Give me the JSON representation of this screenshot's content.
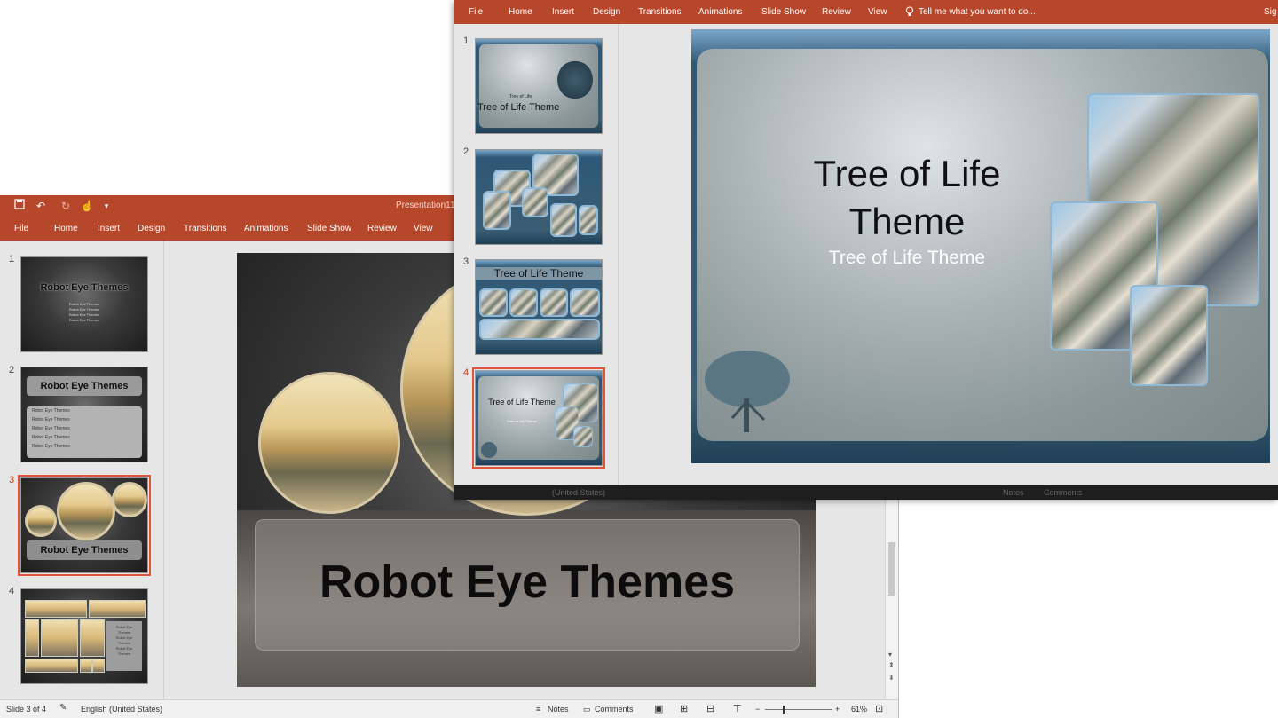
{
  "win1": {
    "doc_title": "Presentation11 -",
    "tabs": [
      "File",
      "Home",
      "Insert",
      "Design",
      "Transitions",
      "Animations",
      "Slide Show",
      "Review",
      "View"
    ],
    "thumbs": [
      {
        "num": "1",
        "title": "Robot Eye Themes",
        "lines": [
          "Robot Eye Themes",
          "Robot Eye Themes",
          "Robot Eye Themes",
          "Robot Eye Themes"
        ]
      },
      {
        "num": "2",
        "title": "Robot Eye Themes",
        "bullets": [
          "Robot Eye Themes",
          "Robot Eye Themes",
          "Robot Eye Themes",
          "Robot Eye Themes",
          "Robot Eye Themes"
        ]
      },
      {
        "num": "3",
        "title": "Robot Eye Themes"
      },
      {
        "num": "4",
        "lines": [
          "Robot Eye",
          "Themes",
          "Robot Eye",
          "Themes",
          "Robot Eye",
          "Themes"
        ]
      }
    ],
    "slide_title": "Robot Eye Themes",
    "status": {
      "slide": "Slide 3 of 4",
      "language": "English (United States)",
      "notes": "Notes",
      "comments": "Comments",
      "zoom": "61%"
    }
  },
  "win2": {
    "tabs": [
      "File",
      "Home",
      "Insert",
      "Design",
      "Transitions",
      "Animations",
      "Slide Show",
      "Review",
      "View"
    ],
    "tell_me": "Tell me what you want to do...",
    "sign": "Sig",
    "thumbs": [
      {
        "num": "1",
        "subtitle": "Tree of Life",
        "title": "Tree of Life Theme"
      },
      {
        "num": "2"
      },
      {
        "num": "3",
        "title": "Tree of Life Theme"
      },
      {
        "num": "4",
        "title": "Tree of Life Theme",
        "subtitle": "Tree of Life Theme"
      }
    ],
    "slide_title": "Tree of Life Theme",
    "slide_subtitle": "Tree of Life Theme",
    "status": {
      "language": "(United States)",
      "notes": "Notes",
      "comments": "Comments"
    }
  },
  "icons": [
    "save-icon",
    "undo-icon",
    "redo-icon",
    "touch-mode-icon",
    "customize-icon",
    "lightbulb-icon",
    "notes-icon",
    "comments-icon",
    "normal-view-icon",
    "slide-sorter-icon",
    "reading-view-icon",
    "slideshow-icon",
    "fit-to-window-icon"
  ]
}
